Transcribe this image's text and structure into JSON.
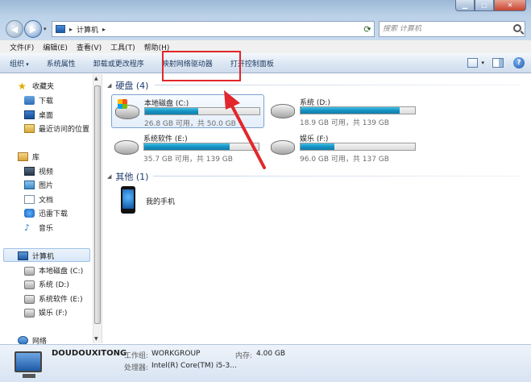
{
  "address": {
    "location": "计算机"
  },
  "search": {
    "placeholder": "搜索 计算机"
  },
  "menu": [
    "文件(F)",
    "编辑(E)",
    "查看(V)",
    "工具(T)",
    "帮助(H)"
  ],
  "toolbar": {
    "organize": "组织",
    "system_properties": "系统属性",
    "uninstall": "卸载或更改程序",
    "map_drive": "映射网络驱动器",
    "control_panel": "打开控制面板"
  },
  "sidebar": {
    "favorites": "收藏夹",
    "downloads": "下载",
    "desktop": "桌面",
    "recent": "最近访问的位置",
    "libraries": "库",
    "videos": "视频",
    "pictures": "图片",
    "documents": "文档",
    "xunlei": "迅雷下载",
    "music": "音乐",
    "computer": "计算机",
    "drive_c": "本地磁盘 (C:)",
    "drive_d": "系统 (D:)",
    "drive_e": "系统软件 (E:)",
    "drive_f": "娱乐 (F:)",
    "network": "网络"
  },
  "groups": {
    "hdd": "硬盘 (4)",
    "other": "其他 (1)"
  },
  "drives": [
    {
      "name": "本地磁盘 (C:)",
      "info": "26.8 GB 可用，共 50.0 GB",
      "used_fraction": 0.464
    },
    {
      "name": "系统 (D:)",
      "info": "18.9 GB 可用，共 139 GB",
      "used_fraction": 0.864
    },
    {
      "name": "系统软件 (E:)",
      "info": "35.7 GB 可用，共 139 GB",
      "used_fraction": 0.743
    },
    {
      "name": "娱乐 (F:)",
      "info": "96.0 GB 可用，共 137 GB",
      "used_fraction": 0.299
    }
  ],
  "other": {
    "phone": "我的手机"
  },
  "details": {
    "computer_name": "DOUDOUXITONG",
    "workgroup_label": "工作组:",
    "workgroup": "WORKGROUP",
    "memory_label": "内存:",
    "memory": "4.00 GB",
    "cpu_label": "处理器:",
    "cpu": "Intel(R) Core(TM) i5-3..."
  },
  "colors": {
    "annotation": "#e2262b",
    "drive_fill": "#1592c2"
  }
}
